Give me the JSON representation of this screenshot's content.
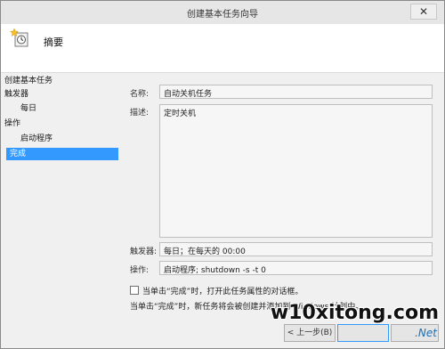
{
  "window": {
    "title": "创建基本任务向导",
    "close_glyph": "✕"
  },
  "header": {
    "title": "摘要",
    "icon": "task-clock-star-icon"
  },
  "sidebar": {
    "items": [
      {
        "label": "创建基本任务",
        "level": 0,
        "active": false
      },
      {
        "label": "触发器",
        "level": 0,
        "active": false
      },
      {
        "label": "每日",
        "level": 1,
        "active": false
      },
      {
        "label": "操作",
        "level": 0,
        "active": false
      },
      {
        "label": "启动程序",
        "level": 1,
        "active": false
      },
      {
        "label": "完成",
        "level": 0,
        "active": true
      }
    ]
  },
  "form": {
    "name_label": "名称:",
    "name_value": "自动关机任务",
    "desc_label": "描述:",
    "desc_value": "定时关机",
    "trigger_label": "触发器:",
    "trigger_value": "每日；在每天的 00:00",
    "action_label": "操作:",
    "action_value": "启动程序; shutdown -s -t 0"
  },
  "options": {
    "open_props_label": "当单击“完成”时，打开此任务属性的对话框。",
    "open_props_checked": false,
    "info": "当单击“完成”时，新任务将会被创建并添加到 Windows 计划中。"
  },
  "buttons": {
    "back": "< 上一步(B)"
  },
  "watermark": {
    "main": "w10xitong.com",
    "sub_prefix": "",
    "sub": ".Net"
  },
  "colors": {
    "selection": "#3399ff"
  }
}
